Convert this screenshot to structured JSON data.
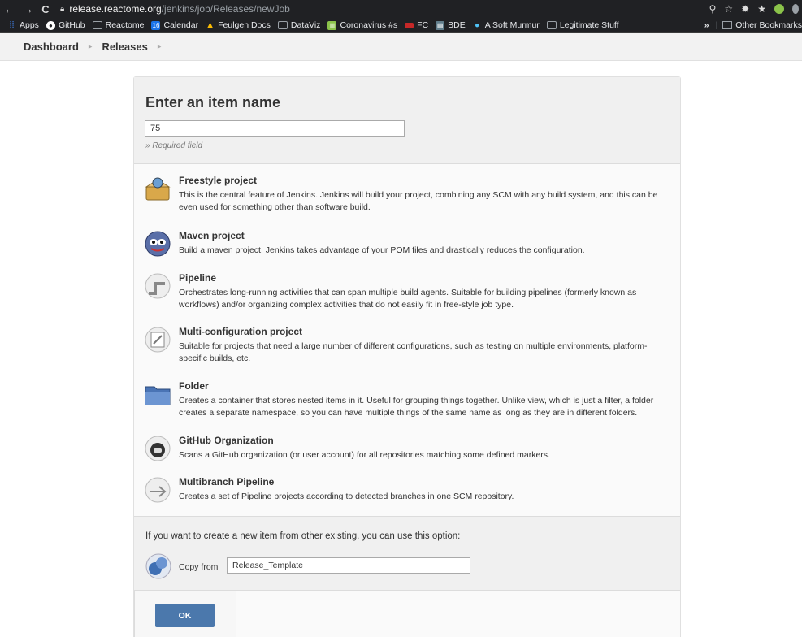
{
  "browser": {
    "url_host": "release.reactome.org",
    "url_path": "/jenkins/job/Releases/newJob",
    "bookmarks": [
      {
        "label": "Apps",
        "color": "#4285f4"
      },
      {
        "label": "GitHub",
        "color": "#ffffff"
      },
      {
        "label": "Reactome",
        "color": "#9aa0a6"
      },
      {
        "label": "Calendar",
        "color": "#1a73e8"
      },
      {
        "label": "Feulgen Docs",
        "color": "#fbbc04"
      },
      {
        "label": "DataViz",
        "color": "#9aa0a6"
      },
      {
        "label": "Coronavirus #s",
        "color": "#8bc34a"
      },
      {
        "label": "FC",
        "color": "#c62828"
      },
      {
        "label": "BDE",
        "color": "#607d8b"
      },
      {
        "label": "A Soft Murmur",
        "color": "#4fc3f7"
      },
      {
        "label": "Legitimate Stuff",
        "color": "#9aa0a6"
      }
    ],
    "overflow": "»",
    "other_bookmarks": "Other Bookmarks"
  },
  "breadcrumb": {
    "items": [
      "Dashboard",
      "Releases"
    ]
  },
  "form": {
    "title": "Enter an item name",
    "item_name_value": "75",
    "required_note": "» Required field"
  },
  "item_types": [
    {
      "title": "Freestyle project",
      "description": "This is the central feature of Jenkins. Jenkins will build your project, combining any SCM with any build system, and this can be even used for something other than software build."
    },
    {
      "title": "Maven project",
      "description": "Build a maven project. Jenkins takes advantage of your POM files and drastically reduces the configuration."
    },
    {
      "title": "Pipeline",
      "description": "Orchestrates long-running activities that can span multiple build agents. Suitable for building pipelines (formerly known as workflows) and/or organizing complex activities that do not easily fit in free-style job type."
    },
    {
      "title": "Multi-configuration project",
      "description": "Suitable for projects that need a large number of different configurations, such as testing on multiple environments, platform-specific builds, etc."
    },
    {
      "title": "Folder",
      "description": "Creates a container that stores nested items in it. Useful for grouping things together. Unlike view, which is just a filter, a folder creates a separate namespace, so you can have multiple things of the same name as long as they are in different folders."
    },
    {
      "title": "GitHub Organization",
      "description": "Scans a GitHub organization (or user account) for all repositories matching some defined markers."
    },
    {
      "title": "Multibranch Pipeline",
      "description": "Creates a set of Pipeline projects according to detected branches in one SCM repository."
    }
  ],
  "copy": {
    "hint": "If you want to create a new item from other existing, you can use this option:",
    "label": "Copy from",
    "value": "Release_Template"
  },
  "ok_label": "OK",
  "colors": {
    "accent": "#4b78ac",
    "chrome": "#202124"
  }
}
